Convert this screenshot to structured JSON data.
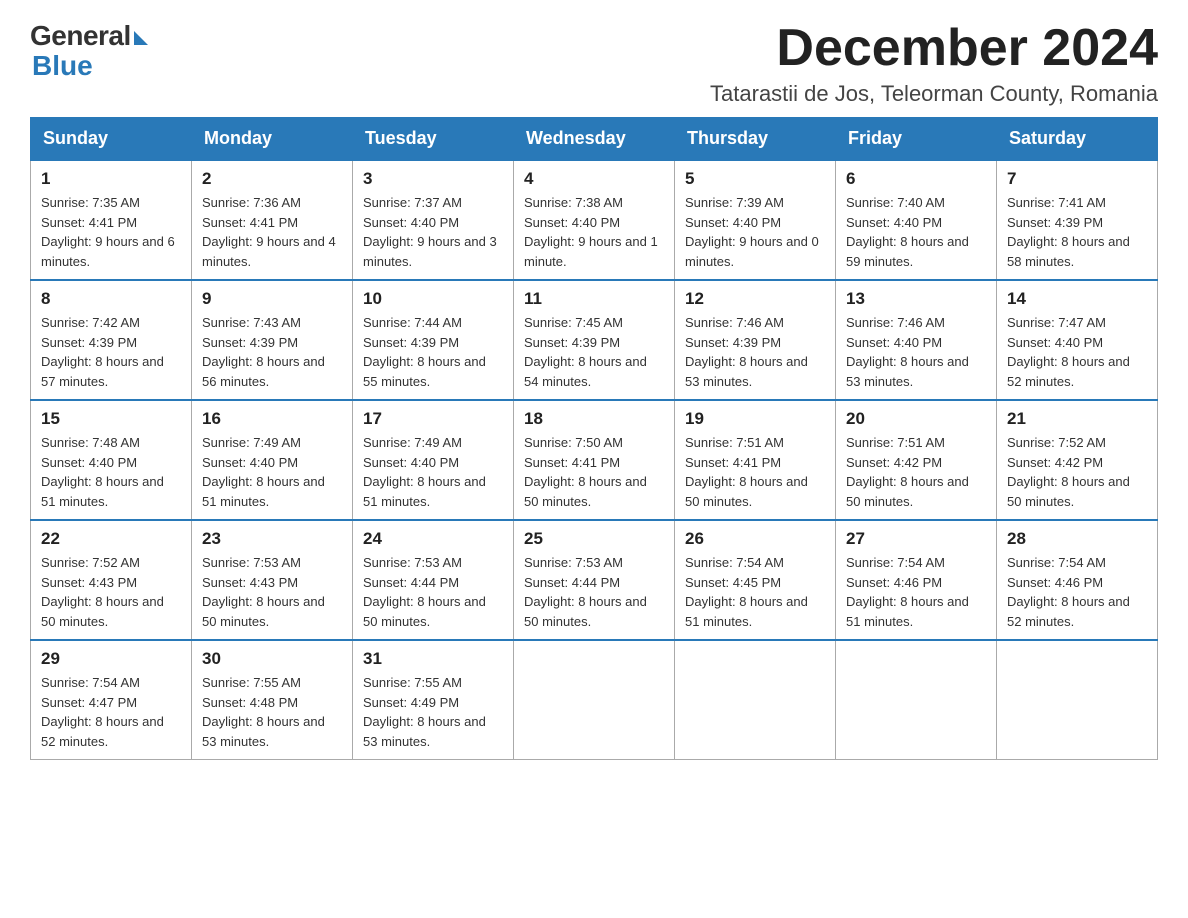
{
  "logo": {
    "general": "General",
    "blue": "Blue"
  },
  "title": {
    "month": "December 2024",
    "location": "Tatarastii de Jos, Teleorman County, Romania"
  },
  "weekdays": [
    "Sunday",
    "Monday",
    "Tuesday",
    "Wednesday",
    "Thursday",
    "Friday",
    "Saturday"
  ],
  "weeks": [
    [
      {
        "day": "1",
        "sunrise": "7:35 AM",
        "sunset": "4:41 PM",
        "daylight": "9 hours and 6 minutes."
      },
      {
        "day": "2",
        "sunrise": "7:36 AM",
        "sunset": "4:41 PM",
        "daylight": "9 hours and 4 minutes."
      },
      {
        "day": "3",
        "sunrise": "7:37 AM",
        "sunset": "4:40 PM",
        "daylight": "9 hours and 3 minutes."
      },
      {
        "day": "4",
        "sunrise": "7:38 AM",
        "sunset": "4:40 PM",
        "daylight": "9 hours and 1 minute."
      },
      {
        "day": "5",
        "sunrise": "7:39 AM",
        "sunset": "4:40 PM",
        "daylight": "9 hours and 0 minutes."
      },
      {
        "day": "6",
        "sunrise": "7:40 AM",
        "sunset": "4:40 PM",
        "daylight": "8 hours and 59 minutes."
      },
      {
        "day": "7",
        "sunrise": "7:41 AM",
        "sunset": "4:39 PM",
        "daylight": "8 hours and 58 minutes."
      }
    ],
    [
      {
        "day": "8",
        "sunrise": "7:42 AM",
        "sunset": "4:39 PM",
        "daylight": "8 hours and 57 minutes."
      },
      {
        "day": "9",
        "sunrise": "7:43 AM",
        "sunset": "4:39 PM",
        "daylight": "8 hours and 56 minutes."
      },
      {
        "day": "10",
        "sunrise": "7:44 AM",
        "sunset": "4:39 PM",
        "daylight": "8 hours and 55 minutes."
      },
      {
        "day": "11",
        "sunrise": "7:45 AM",
        "sunset": "4:39 PM",
        "daylight": "8 hours and 54 minutes."
      },
      {
        "day": "12",
        "sunrise": "7:46 AM",
        "sunset": "4:39 PM",
        "daylight": "8 hours and 53 minutes."
      },
      {
        "day": "13",
        "sunrise": "7:46 AM",
        "sunset": "4:40 PM",
        "daylight": "8 hours and 53 minutes."
      },
      {
        "day": "14",
        "sunrise": "7:47 AM",
        "sunset": "4:40 PM",
        "daylight": "8 hours and 52 minutes."
      }
    ],
    [
      {
        "day": "15",
        "sunrise": "7:48 AM",
        "sunset": "4:40 PM",
        "daylight": "8 hours and 51 minutes."
      },
      {
        "day": "16",
        "sunrise": "7:49 AM",
        "sunset": "4:40 PM",
        "daylight": "8 hours and 51 minutes."
      },
      {
        "day": "17",
        "sunrise": "7:49 AM",
        "sunset": "4:40 PM",
        "daylight": "8 hours and 51 minutes."
      },
      {
        "day": "18",
        "sunrise": "7:50 AM",
        "sunset": "4:41 PM",
        "daylight": "8 hours and 50 minutes."
      },
      {
        "day": "19",
        "sunrise": "7:51 AM",
        "sunset": "4:41 PM",
        "daylight": "8 hours and 50 minutes."
      },
      {
        "day": "20",
        "sunrise": "7:51 AM",
        "sunset": "4:42 PM",
        "daylight": "8 hours and 50 minutes."
      },
      {
        "day": "21",
        "sunrise": "7:52 AM",
        "sunset": "4:42 PM",
        "daylight": "8 hours and 50 minutes."
      }
    ],
    [
      {
        "day": "22",
        "sunrise": "7:52 AM",
        "sunset": "4:43 PM",
        "daylight": "8 hours and 50 minutes."
      },
      {
        "day": "23",
        "sunrise": "7:53 AM",
        "sunset": "4:43 PM",
        "daylight": "8 hours and 50 minutes."
      },
      {
        "day": "24",
        "sunrise": "7:53 AM",
        "sunset": "4:44 PM",
        "daylight": "8 hours and 50 minutes."
      },
      {
        "day": "25",
        "sunrise": "7:53 AM",
        "sunset": "4:44 PM",
        "daylight": "8 hours and 50 minutes."
      },
      {
        "day": "26",
        "sunrise": "7:54 AM",
        "sunset": "4:45 PM",
        "daylight": "8 hours and 51 minutes."
      },
      {
        "day": "27",
        "sunrise": "7:54 AM",
        "sunset": "4:46 PM",
        "daylight": "8 hours and 51 minutes."
      },
      {
        "day": "28",
        "sunrise": "7:54 AM",
        "sunset": "4:46 PM",
        "daylight": "8 hours and 52 minutes."
      }
    ],
    [
      {
        "day": "29",
        "sunrise": "7:54 AM",
        "sunset": "4:47 PM",
        "daylight": "8 hours and 52 minutes."
      },
      {
        "day": "30",
        "sunrise": "7:55 AM",
        "sunset": "4:48 PM",
        "daylight": "8 hours and 53 minutes."
      },
      {
        "day": "31",
        "sunrise": "7:55 AM",
        "sunset": "4:49 PM",
        "daylight": "8 hours and 53 minutes."
      },
      null,
      null,
      null,
      null
    ]
  ],
  "labels": {
    "sunrise": "Sunrise:",
    "sunset": "Sunset:",
    "daylight": "Daylight:"
  }
}
